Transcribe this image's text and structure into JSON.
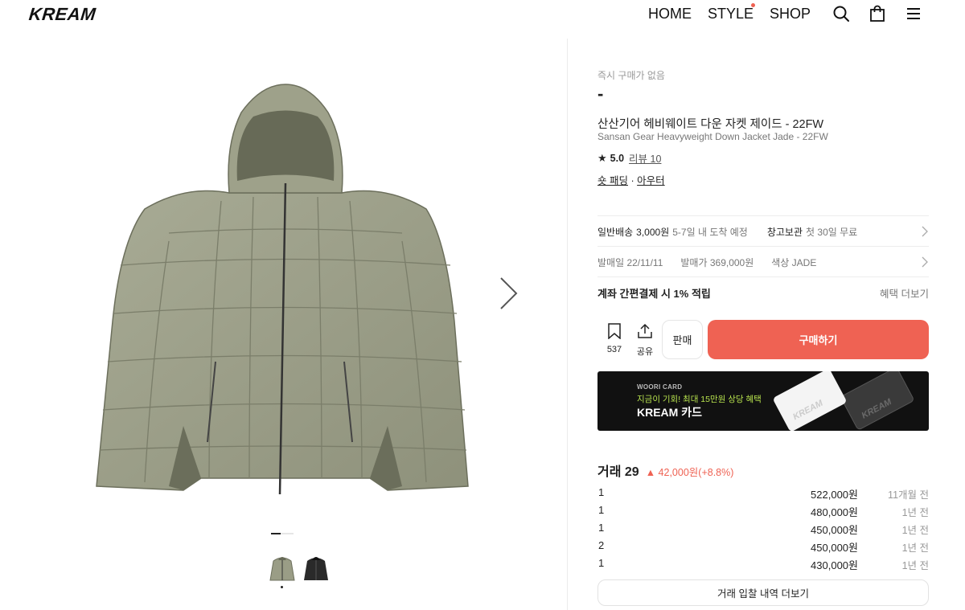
{
  "header": {
    "logo": "KREAM",
    "nav": {
      "home": "HOME",
      "style": "STYLE",
      "shop": "SHOP"
    },
    "icons": [
      "search-icon",
      "shopping-bag-icon",
      "menu-icon"
    ]
  },
  "gallery": {
    "image_subject": "olive green hooded down jacket",
    "image_count": 2,
    "active_index": 1,
    "thumbnails": [
      "olive-jacket-thumbnail",
      "black-jacket-thumbnail"
    ]
  },
  "product": {
    "instant_label": "즉시 구매가 없음",
    "price": "-",
    "title_ko": "산산기어 헤비웨이트 다운 자켓 제이드 - 22FW",
    "title_en": "Sansan Gear Heavyweight Down Jacket Jade - 22FW",
    "rating": "5.0",
    "review": "리뷰 10",
    "tags": [
      "숏 패딩",
      "아우터"
    ],
    "tag_separator": "·"
  },
  "shipping": {
    "label": "일반배송",
    "fee": "3,000원",
    "eta": "5-7일 내 도착 예정",
    "storage_label": "창고보관",
    "storage_desc": "첫 30일 무료"
  },
  "meta": {
    "release": "발매일 22/11/11",
    "retail": "발매가 369,000원",
    "color": "색상 JADE"
  },
  "payment": {
    "promo": "계좌 간편결제 시 1% 적립",
    "more": "혜택 더보기"
  },
  "actions": {
    "wish_count": "537",
    "share_label": "공유",
    "sell_label": "판매",
    "buy_label": "구매하기"
  },
  "banner": {
    "small": "WOORI CARD",
    "mid": "지금이 기회! 최대 15만원 상당 혜택",
    "big": "KREAM 카드",
    "card_text": "KREAM"
  },
  "trades": {
    "title": "거래 29",
    "change": "42,000원(+8.8%)",
    "rows": [
      {
        "qty": "1",
        "price": "522,000원",
        "time": "11개월 전"
      },
      {
        "qty": "1",
        "price": "480,000원",
        "time": "1년 전"
      },
      {
        "qty": "1",
        "price": "450,000원",
        "time": "1년 전"
      },
      {
        "qty": "2",
        "price": "450,000원",
        "time": "1년 전"
      },
      {
        "qty": "1",
        "price": "430,000원",
        "time": "1년 전"
      }
    ],
    "more_label": "거래 입찰 내역 더보기"
  },
  "colors": {
    "accent": "#ef6253",
    "jacket": "#9a9d86",
    "banner_bg": "#111111",
    "banner_highlight": "#b6e14d"
  }
}
